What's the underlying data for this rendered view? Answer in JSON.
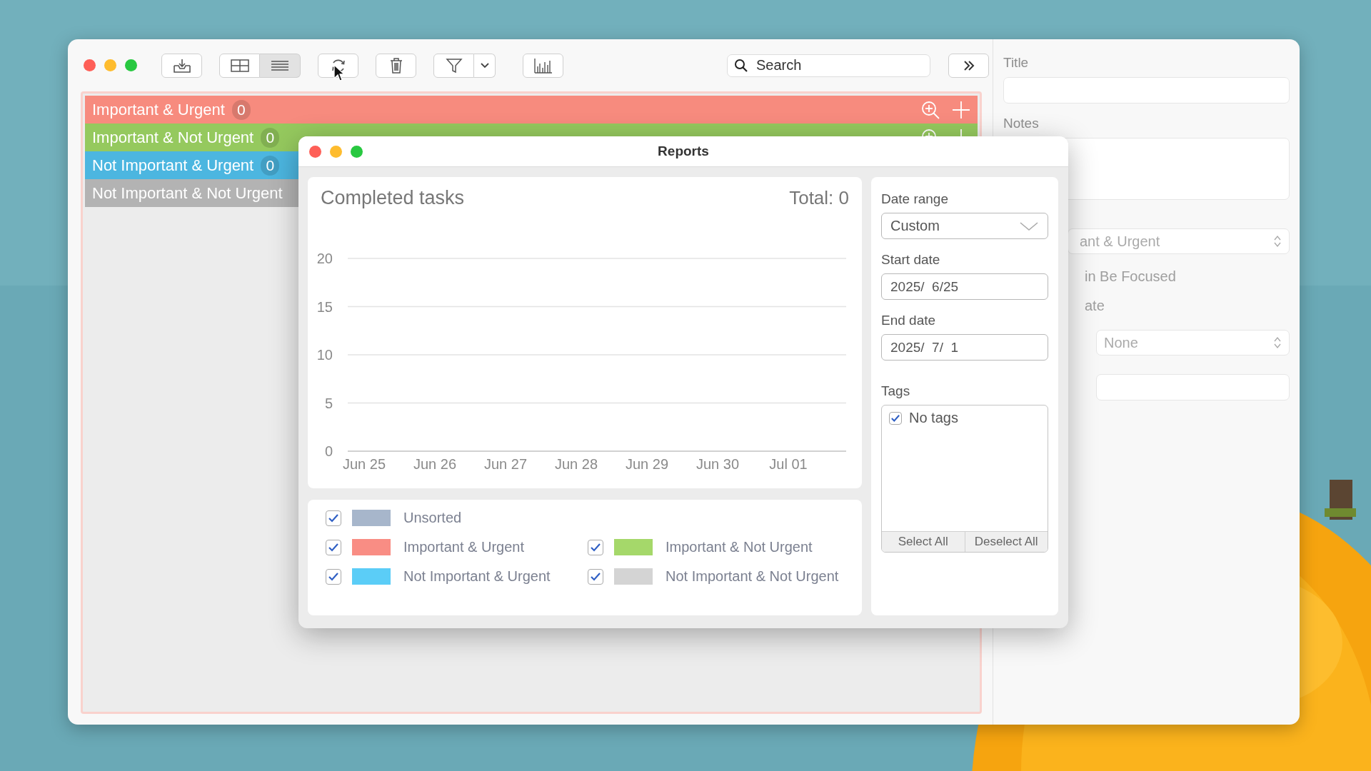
{
  "main_window": {
    "toolbar": {
      "search": {
        "placeholder": "Search"
      }
    },
    "categories": [
      {
        "name": "Important & Urgent",
        "count": "0",
        "color": "#f78b7e",
        "actions": true
      },
      {
        "name": "Important & Not Urgent",
        "count": "0",
        "color": "#95c95e",
        "actions": true
      },
      {
        "name": "Not Important & Urgent",
        "count": "0",
        "color": "#4cb6e0"
      },
      {
        "name": "Not Important & Not Urgent",
        "color": "#b3b3b3"
      }
    ]
  },
  "details": {
    "title_label": "Title",
    "notes_label": "Notes",
    "category_value": "ant & Urgent",
    "focus_label": "in Be Focused",
    "date_label": "ate",
    "repeat_value": "None"
  },
  "reports": {
    "title": "Reports",
    "chart_title": "Completed tasks",
    "total": "Total: 0",
    "chart_data": {
      "type": "line",
      "categories": [
        "Jun 25",
        "Jun 26",
        "Jun 27",
        "Jun 28",
        "Jun 29",
        "Jun 30",
        "Jul 01"
      ],
      "ylim": [
        0,
        20
      ],
      "yticks": [
        0,
        5,
        10,
        15,
        20
      ],
      "grid": true
    },
    "legend": [
      {
        "label": "Unsorted",
        "color": "#a7b6cb",
        "checked": true
      },
      {
        "label": "Important & Urgent",
        "color": "#f98d84",
        "checked": true
      },
      {
        "label": "Important & Not Urgent",
        "color": "#a5d86a",
        "checked": true
      },
      {
        "label": "Not Important & Urgent",
        "color": "#5bcdf7",
        "checked": true
      },
      {
        "label": "Not Important & Not Urgent",
        "color": "#d4d4d4",
        "checked": true
      }
    ],
    "date_range_label": "Date range",
    "date_range": "Custom",
    "start_label": "Start date",
    "start_date": "2025/  6/25",
    "end_label": "End date",
    "end_date": "2025/  7/  1",
    "tags_label": "Tags",
    "tags": [
      {
        "name": "No tags",
        "checked": true
      }
    ],
    "buttons": [
      "Select All",
      "Deselect All"
    ]
  }
}
